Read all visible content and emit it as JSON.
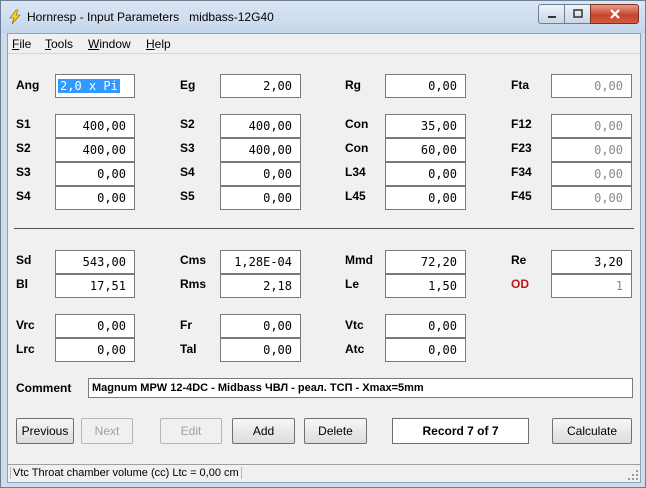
{
  "window": {
    "title": "Hornresp - Input Parameters",
    "subtitle": "midbass-12G40",
    "accent_close": "#c8452d"
  },
  "menu": {
    "items": [
      {
        "label": "File",
        "key": "F"
      },
      {
        "label": "Tools",
        "key": "T"
      },
      {
        "label": "Window",
        "key": "W"
      },
      {
        "label": "Help",
        "key": "H"
      }
    ]
  },
  "params": {
    "Ang": {
      "label": "Ang",
      "value": "2,0 x Pi"
    },
    "Eg": {
      "label": "Eg",
      "value": "2,00"
    },
    "Rg": {
      "label": "Rg",
      "value": "0,00"
    },
    "Fta": {
      "label": "Fta",
      "value": "0,00"
    },
    "S1": {
      "label": "S1",
      "value": "400,00"
    },
    "S2": {
      "label": "S2",
      "value": "400,00"
    },
    "S3": {
      "label": "S3",
      "value": "0,00"
    },
    "S4": {
      "label": "S4",
      "value": "0,00"
    },
    "S2b": {
      "label": "S2",
      "value": "400,00"
    },
    "S3b": {
      "label": "S3",
      "value": "400,00"
    },
    "S4b": {
      "label": "S4",
      "value": "0,00"
    },
    "S5": {
      "label": "S5",
      "value": "0,00"
    },
    "Con1": {
      "label": "Con",
      "value": "35,00"
    },
    "Con2": {
      "label": "Con",
      "value": "60,00"
    },
    "L34": {
      "label": "L34",
      "value": "0,00"
    },
    "L45": {
      "label": "L45",
      "value": "0,00"
    },
    "F12": {
      "label": "F12",
      "value": "0,00"
    },
    "F23": {
      "label": "F23",
      "value": "0,00"
    },
    "F34": {
      "label": "F34",
      "value": "0,00"
    },
    "F45": {
      "label": "F45",
      "value": "0,00"
    },
    "Sd": {
      "label": "Sd",
      "value": "543,00"
    },
    "Bl": {
      "label": "Bl",
      "value": "17,51"
    },
    "Cms": {
      "label": "Cms",
      "value": "1,28E-04"
    },
    "Rms": {
      "label": "Rms",
      "value": "2,18"
    },
    "Mmd": {
      "label": "Mmd",
      "value": "72,20"
    },
    "Le": {
      "label": "Le",
      "value": "1,50"
    },
    "Re": {
      "label": "Re",
      "value": "3,20"
    },
    "OD": {
      "label": "OD",
      "value": "1"
    },
    "Vrc": {
      "label": "Vrc",
      "value": "0,00"
    },
    "Lrc": {
      "label": "Lrc",
      "value": "0,00"
    },
    "Fr": {
      "label": "Fr",
      "value": "0,00"
    },
    "Tal": {
      "label": "Tal",
      "value": "0,00"
    },
    "Vtc": {
      "label": "Vtc",
      "value": "0,00"
    },
    "Atc": {
      "label": "Atc",
      "value": "0,00"
    }
  },
  "comment": {
    "label": "Comment",
    "value": "Magnum MPW 12-4DC - Midbass ЧВЛ - реал. ТСП - Xmax=5mm"
  },
  "buttons": {
    "previous": "Previous",
    "next": "Next",
    "edit": "Edit",
    "add": "Add",
    "delete": "Delete",
    "record": "Record 7 of 7",
    "calculate": "Calculate"
  },
  "status": {
    "text": "Vtc   Throat chamber volume  (cc)   Ltc = 0,00 cm"
  }
}
